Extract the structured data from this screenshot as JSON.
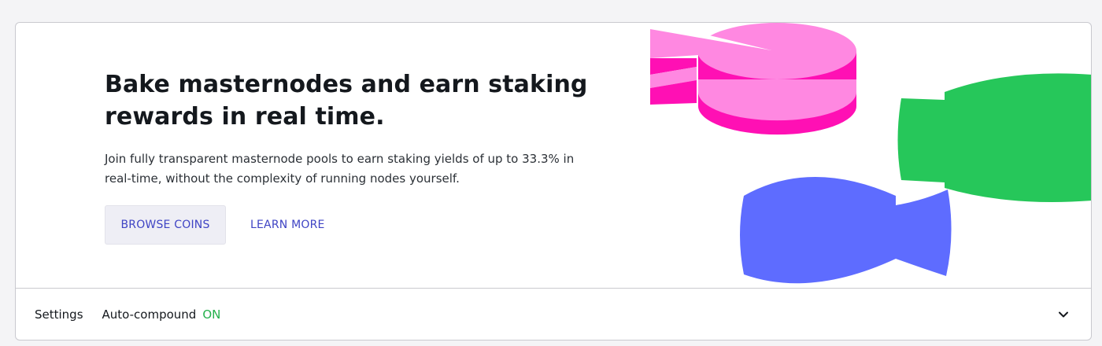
{
  "hero": {
    "headline": "Bake masternodes and earn staking rewards in real time.",
    "description": "Join fully transparent masternode pools to earn staking yields of up to 33.3% in real-time, without the complexity of running nodes yourself.",
    "primary_button": "BROWSE COINS",
    "secondary_button": "LEARN MORE",
    "illustration_icons": [
      "pink-layered-pie-icon",
      "green-video-camera-icon",
      "blue-video-camera-icon"
    ]
  },
  "settings": {
    "label": "Settings",
    "auto_compound_label": "Auto-compound",
    "auto_compound_status": "ON",
    "expand_icon": "chevron-down-icon"
  },
  "colors": {
    "accent": "#3f44c4",
    "status_on": "#24b04c",
    "pink": "#ff88e1",
    "magenta": "#ff10b4",
    "green": "#26c75a",
    "blue": "#5e6cff"
  }
}
